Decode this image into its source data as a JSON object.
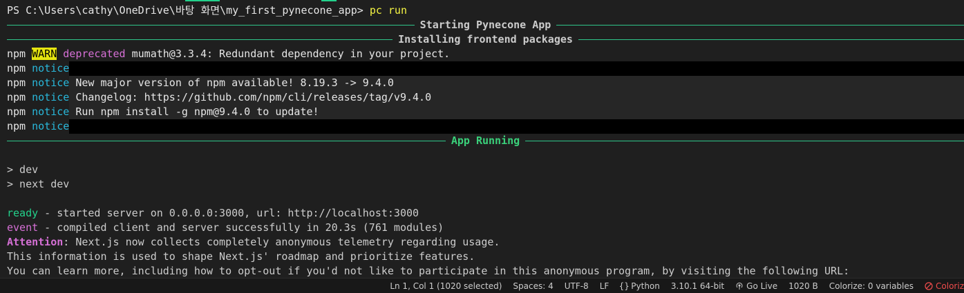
{
  "prompt": {
    "path": "PS C:\\Users\\cathy\\OneDrive\\바탕 화면\\my_first_pynecone_app>",
    "command": "pc run"
  },
  "rules": {
    "starting": "Starting Pynecone App",
    "installing": "Installing frontend packages",
    "running": "App Running"
  },
  "npm_lines": [
    {
      "npm": "npm",
      "tag": "WARN",
      "kind": "deprecated",
      "text": " mumath@3.3.4: Redundant dependency in your project."
    },
    {
      "npm": "npm",
      "tag": "notice",
      "text": ""
    },
    {
      "npm": "npm",
      "tag": "notice",
      "text": " New major version of npm available! 8.19.3 -> 9.4.0"
    },
    {
      "npm": "npm",
      "tag": "notice",
      "text": " Changelog: https://github.com/npm/cli/releases/tag/v9.4.0"
    },
    {
      "npm": "npm",
      "tag": "notice",
      "text": " Run npm install -g npm@9.4.0 to update!"
    },
    {
      "npm": "npm",
      "tag": "notice",
      "text": ""
    }
  ],
  "dev_lines": [
    "> dev",
    "> next dev"
  ],
  "log": {
    "ready_tag": "ready",
    "ready_text": " - started server on 0.0.0.0:3000, url: http://localhost:3000",
    "event_tag": "event",
    "event_text": " - compiled client and server successfully in 20.3s (761 modules)",
    "attention_tag": "Attention",
    "attention_text": ": Next.js now collects completely anonymous telemetry regarding usage.",
    "info1": "This information is used to shape Next.js' roadmap and prioritize features.",
    "info2": "You can learn more, including how to opt-out if you'd not like to participate in this anonymous program, by visiting the following URL:"
  },
  "statusbar": {
    "position": "Ln 1, Col 1 (1020 selected)",
    "spaces": "Spaces: 4",
    "encoding": "UTF-8",
    "eol": "LF",
    "language": "Python",
    "interpreter": "3.10.1 64-bit",
    "golive": "Go Live",
    "size": "1020 B",
    "colorize": "Colorize: 0 variables",
    "colorize_error": "Coloriz"
  },
  "colors": {
    "rule": "#2fc78b",
    "warn_bg": "#e5e510",
    "notice": "#29b8db",
    "deprecated": "#d670d6",
    "ready": "#23d18b"
  }
}
